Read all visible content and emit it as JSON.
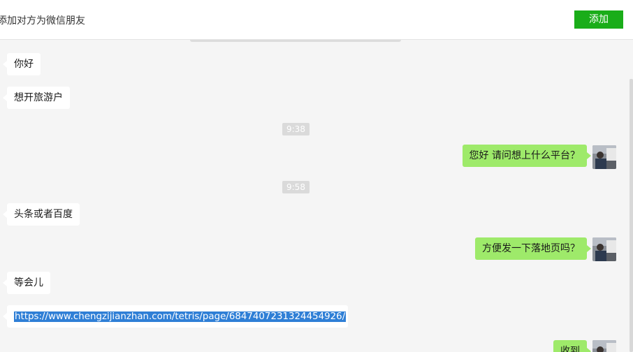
{
  "header": {
    "notice": "添加对方为微信朋友",
    "add_button": "添加"
  },
  "colors": {
    "accent_green": "#1aad19",
    "outgoing_bubble": "#9eea6a",
    "incoming_bubble": "#ffffff",
    "link_highlight": "#2f7fd6"
  },
  "messages": [
    {
      "dir": "in",
      "text": "你好"
    },
    {
      "dir": "in",
      "text": "想开旅游户"
    },
    {
      "dir": "time",
      "text": "9:38"
    },
    {
      "dir": "out",
      "text": "您好 请问想上什么平台？"
    },
    {
      "dir": "time",
      "text": "9:58"
    },
    {
      "dir": "in",
      "text": "头条或者百度"
    },
    {
      "dir": "out",
      "text": "方便发一下落地页吗？"
    },
    {
      "dir": "in",
      "text": "等会儿"
    },
    {
      "dir": "in",
      "text": "https://www.chengzijianzhan.com/tetris/page/6847407231324454926/"
    },
    {
      "dir": "out",
      "text": "收到"
    }
  ]
}
